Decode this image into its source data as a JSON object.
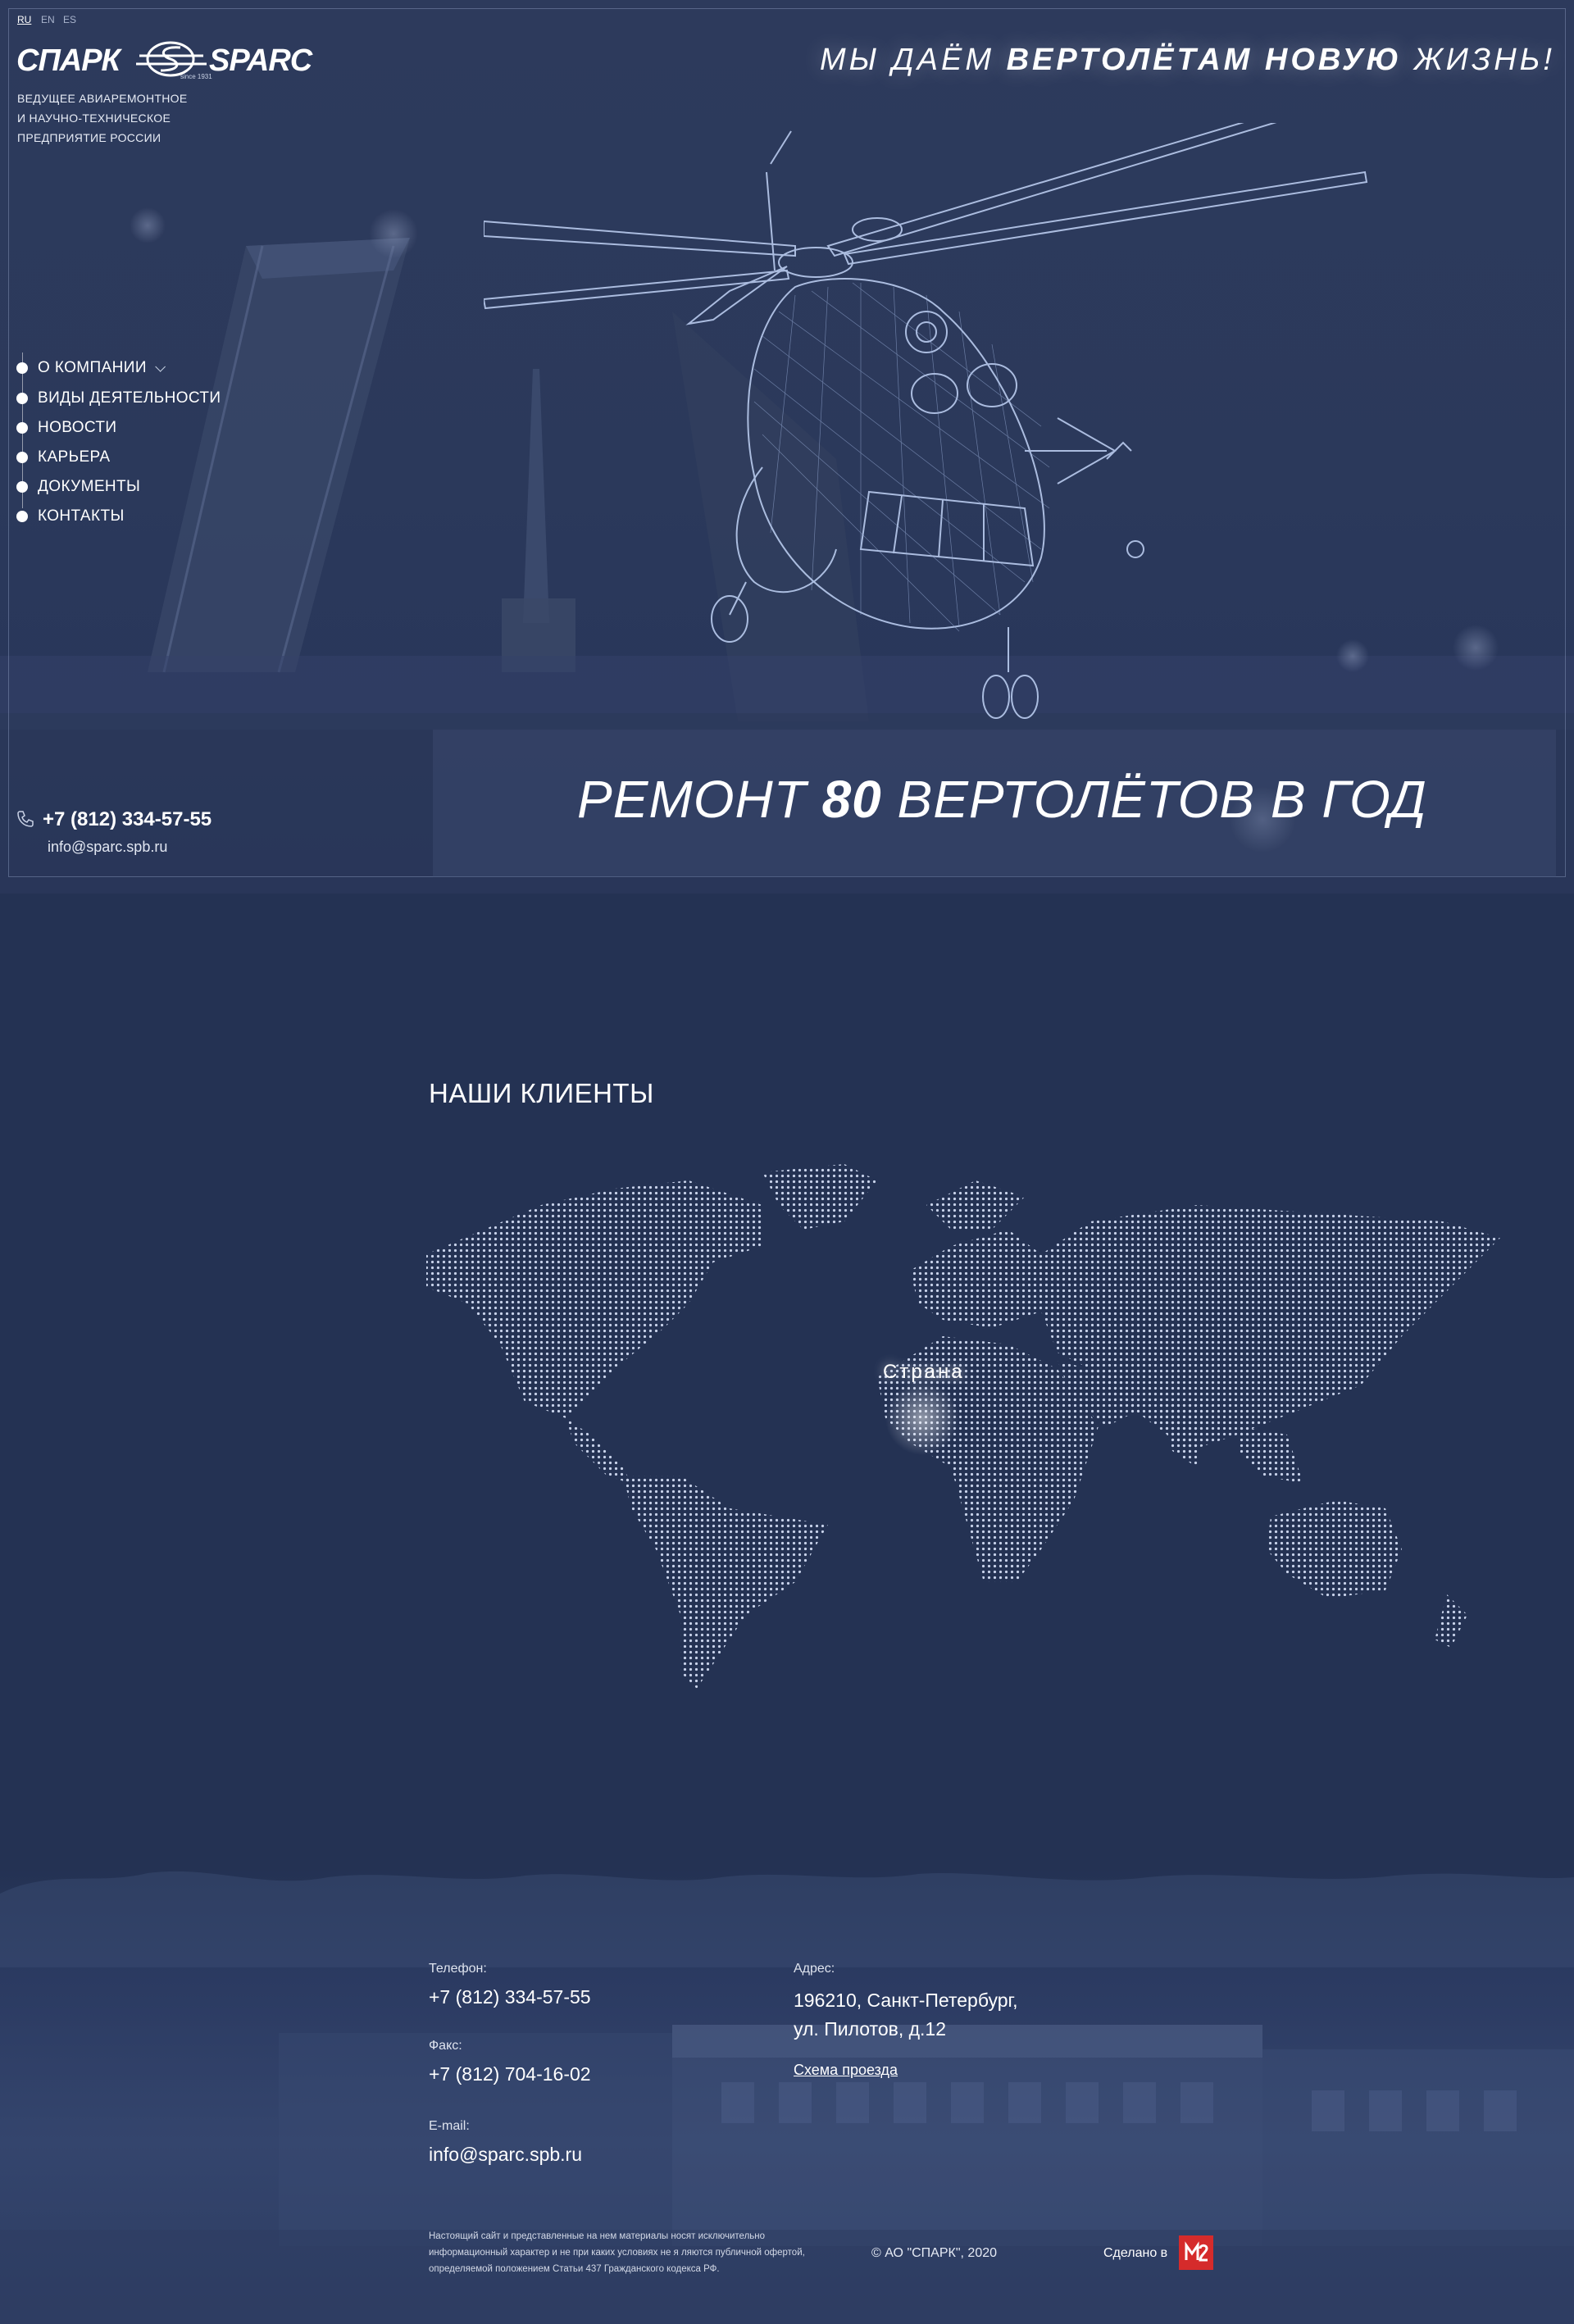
{
  "languages": [
    "RU",
    "EN",
    "ES"
  ],
  "logo": {
    "text_ru": "СПАРК",
    "text_en": "SPARC",
    "since": "since 1931"
  },
  "tagline": [
    "ВЕДУЩЕЕ АВИАРЕМОНТНОЕ",
    "И НАУЧНО-ТЕХНИЧЕСКОЕ",
    "ПРЕДПРИЯТИЕ РОССИИ"
  ],
  "slogan": {
    "pre": "МЫ ДАЁМ ",
    "bold": "ВЕРТОЛЁТАМ НОВУЮ",
    "post": " ЖИЗНЬ!"
  },
  "nav": [
    {
      "label": "О КОМПАНИИ",
      "has_dropdown": true
    },
    {
      "label": "ВИДЫ ДЕЯТЕЛЬНОСТИ"
    },
    {
      "label": "НОВОСТИ"
    },
    {
      "label": "КАРЬЕРА"
    },
    {
      "label": "ДОКУМЕНТЫ"
    },
    {
      "label": "КОНТАКТЫ"
    }
  ],
  "contact_top": {
    "phone": "+7 (812) 334-57-55",
    "email": "info@sparc.spb.ru"
  },
  "hero_banner": {
    "pre": "РЕМОНТ ",
    "bold": "80",
    "post": " ВЕРТОЛЁТОВ В ГОД"
  },
  "clients": {
    "title": "НАШИ КЛИЕНТЫ",
    "map_label": "Страна"
  },
  "footer": {
    "phone_label": "Телефон:",
    "phone": "+7 (812) 334-57-55",
    "fax_label": "Факс:",
    "fax": "+7 (812) 704-16-02",
    "email_label": "E-mail:",
    "email": "info@sparc.spb.ru",
    "address_label": "Адрес:",
    "address_line1": "196210, Санкт-Петербург,",
    "address_line2": "ул. Пилотов, д.12",
    "map_link": "Схема проезда",
    "disclaimer": "Настоящий сайт и представленные на нем материалы носят исключительно информационный характер и не при каких  условиях не я ляются публичной офертой, определяемой положением Статьи 437 Гражданского кодекса РФ.",
    "copyright": "© АО \"СПАРК\", 2020",
    "made_in": "Сделано в"
  },
  "colors": {
    "background": "#243253",
    "accent_red": "#d52b2b"
  }
}
